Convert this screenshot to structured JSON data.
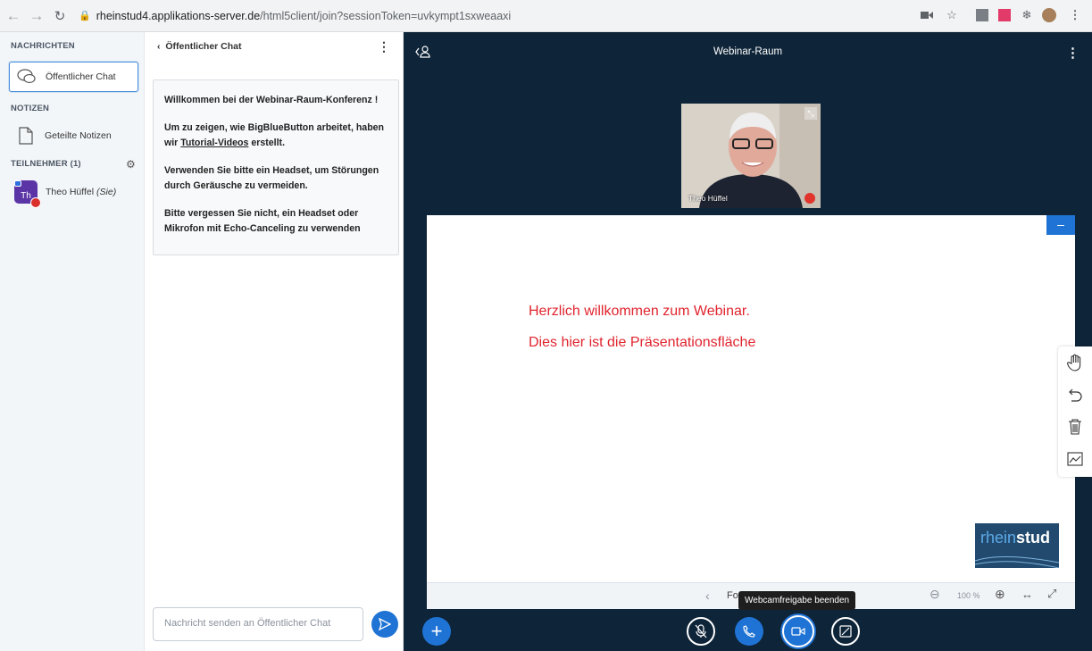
{
  "browser": {
    "url_host": "rheinstud4.applikations-server.de",
    "url_path": "/html5client/join?sessionToken=uvkympt1sxweaaxi"
  },
  "sidebar": {
    "messages_heading": "NACHRICHTEN",
    "public_chat_label": "Öffentlicher Chat",
    "notes_heading": "NOTIZEN",
    "shared_notes_label": "Geteilte Notizen",
    "participants_heading": "TEILNEHMER (1)",
    "user_initials": "Th",
    "user_name": "Theo Hüffel",
    "user_suffix": "(Sie)"
  },
  "chat": {
    "back_label": "Öffentlicher Chat",
    "welcome_pre": "Willkommen bei der ",
    "welcome_room": "Webinar-Raum",
    "welcome_post": "-Konferenz !",
    "tutorial_pre": "Um zu zeigen, wie BigBlueButton arbeitet, haben wir ",
    "tutorial_link": "Tutorial-Videos",
    "tutorial_post": " erstellt.",
    "headset_text": "Verwenden Sie bitte ein Headset, um Störungen durch Geräusche zu vermeiden.",
    "mic_text": "Bitte vergessen Sie nicht, ein Headset oder Mikrofon mit Echo-Canceling zu verwenden",
    "input_placeholder": "Nachricht senden an Öffentlicher Chat"
  },
  "main": {
    "room_title": "Webinar-Raum",
    "webcam_name": "Theo Hüffel",
    "slide_line1": "Herzlich willkommen zum Webinar.",
    "slide_line2": "Dies hier ist die Präsentationsfläche",
    "logo_light": "rhein",
    "logo_bold": "stud",
    "slide_select_fragment": "Fo",
    "zoom_level": "100 %",
    "tooltip": "Webcamfreigabe beenden"
  },
  "colors": {
    "main_bg": "#0e2438",
    "accent": "#1f73d4",
    "slide_red": "#e0242e"
  }
}
